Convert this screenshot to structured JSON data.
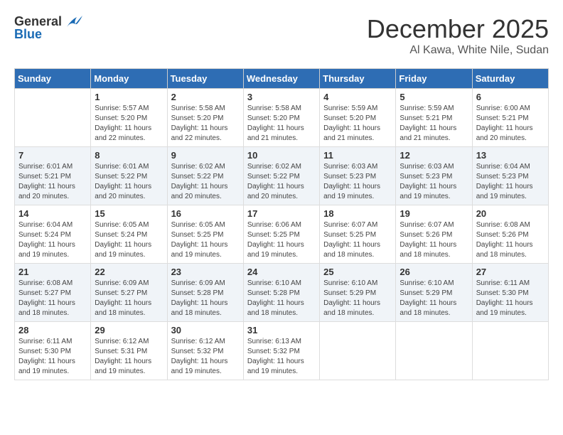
{
  "logo": {
    "line1": "General",
    "line2": "Blue"
  },
  "title": "December 2025",
  "location": "Al Kawa, White Nile, Sudan",
  "days_of_week": [
    "Sunday",
    "Monday",
    "Tuesday",
    "Wednesday",
    "Thursday",
    "Friday",
    "Saturday"
  ],
  "weeks": [
    [
      {
        "day": "",
        "sunrise": "",
        "sunset": "",
        "daylight": ""
      },
      {
        "day": "1",
        "sunrise": "Sunrise: 5:57 AM",
        "sunset": "Sunset: 5:20 PM",
        "daylight": "Daylight: 11 hours and 22 minutes."
      },
      {
        "day": "2",
        "sunrise": "Sunrise: 5:58 AM",
        "sunset": "Sunset: 5:20 PM",
        "daylight": "Daylight: 11 hours and 22 minutes."
      },
      {
        "day": "3",
        "sunrise": "Sunrise: 5:58 AM",
        "sunset": "Sunset: 5:20 PM",
        "daylight": "Daylight: 11 hours and 21 minutes."
      },
      {
        "day": "4",
        "sunrise": "Sunrise: 5:59 AM",
        "sunset": "Sunset: 5:20 PM",
        "daylight": "Daylight: 11 hours and 21 minutes."
      },
      {
        "day": "5",
        "sunrise": "Sunrise: 5:59 AM",
        "sunset": "Sunset: 5:21 PM",
        "daylight": "Daylight: 11 hours and 21 minutes."
      },
      {
        "day": "6",
        "sunrise": "Sunrise: 6:00 AM",
        "sunset": "Sunset: 5:21 PM",
        "daylight": "Daylight: 11 hours and 20 minutes."
      }
    ],
    [
      {
        "day": "7",
        "sunrise": "Sunrise: 6:01 AM",
        "sunset": "Sunset: 5:21 PM",
        "daylight": "Daylight: 11 hours and 20 minutes."
      },
      {
        "day": "8",
        "sunrise": "Sunrise: 6:01 AM",
        "sunset": "Sunset: 5:22 PM",
        "daylight": "Daylight: 11 hours and 20 minutes."
      },
      {
        "day": "9",
        "sunrise": "Sunrise: 6:02 AM",
        "sunset": "Sunset: 5:22 PM",
        "daylight": "Daylight: 11 hours and 20 minutes."
      },
      {
        "day": "10",
        "sunrise": "Sunrise: 6:02 AM",
        "sunset": "Sunset: 5:22 PM",
        "daylight": "Daylight: 11 hours and 20 minutes."
      },
      {
        "day": "11",
        "sunrise": "Sunrise: 6:03 AM",
        "sunset": "Sunset: 5:23 PM",
        "daylight": "Daylight: 11 hours and 19 minutes."
      },
      {
        "day": "12",
        "sunrise": "Sunrise: 6:03 AM",
        "sunset": "Sunset: 5:23 PM",
        "daylight": "Daylight: 11 hours and 19 minutes."
      },
      {
        "day": "13",
        "sunrise": "Sunrise: 6:04 AM",
        "sunset": "Sunset: 5:23 PM",
        "daylight": "Daylight: 11 hours and 19 minutes."
      }
    ],
    [
      {
        "day": "14",
        "sunrise": "Sunrise: 6:04 AM",
        "sunset": "Sunset: 5:24 PM",
        "daylight": "Daylight: 11 hours and 19 minutes."
      },
      {
        "day": "15",
        "sunrise": "Sunrise: 6:05 AM",
        "sunset": "Sunset: 5:24 PM",
        "daylight": "Daylight: 11 hours and 19 minutes."
      },
      {
        "day": "16",
        "sunrise": "Sunrise: 6:05 AM",
        "sunset": "Sunset: 5:25 PM",
        "daylight": "Daylight: 11 hours and 19 minutes."
      },
      {
        "day": "17",
        "sunrise": "Sunrise: 6:06 AM",
        "sunset": "Sunset: 5:25 PM",
        "daylight": "Daylight: 11 hours and 19 minutes."
      },
      {
        "day": "18",
        "sunrise": "Sunrise: 6:07 AM",
        "sunset": "Sunset: 5:25 PM",
        "daylight": "Daylight: 11 hours and 18 minutes."
      },
      {
        "day": "19",
        "sunrise": "Sunrise: 6:07 AM",
        "sunset": "Sunset: 5:26 PM",
        "daylight": "Daylight: 11 hours and 18 minutes."
      },
      {
        "day": "20",
        "sunrise": "Sunrise: 6:08 AM",
        "sunset": "Sunset: 5:26 PM",
        "daylight": "Daylight: 11 hours and 18 minutes."
      }
    ],
    [
      {
        "day": "21",
        "sunrise": "Sunrise: 6:08 AM",
        "sunset": "Sunset: 5:27 PM",
        "daylight": "Daylight: 11 hours and 18 minutes."
      },
      {
        "day": "22",
        "sunrise": "Sunrise: 6:09 AM",
        "sunset": "Sunset: 5:27 PM",
        "daylight": "Daylight: 11 hours and 18 minutes."
      },
      {
        "day": "23",
        "sunrise": "Sunrise: 6:09 AM",
        "sunset": "Sunset: 5:28 PM",
        "daylight": "Daylight: 11 hours and 18 minutes."
      },
      {
        "day": "24",
        "sunrise": "Sunrise: 6:10 AM",
        "sunset": "Sunset: 5:28 PM",
        "daylight": "Daylight: 11 hours and 18 minutes."
      },
      {
        "day": "25",
        "sunrise": "Sunrise: 6:10 AM",
        "sunset": "Sunset: 5:29 PM",
        "daylight": "Daylight: 11 hours and 18 minutes."
      },
      {
        "day": "26",
        "sunrise": "Sunrise: 6:10 AM",
        "sunset": "Sunset: 5:29 PM",
        "daylight": "Daylight: 11 hours and 18 minutes."
      },
      {
        "day": "27",
        "sunrise": "Sunrise: 6:11 AM",
        "sunset": "Sunset: 5:30 PM",
        "daylight": "Daylight: 11 hours and 19 minutes."
      }
    ],
    [
      {
        "day": "28",
        "sunrise": "Sunrise: 6:11 AM",
        "sunset": "Sunset: 5:30 PM",
        "daylight": "Daylight: 11 hours and 19 minutes."
      },
      {
        "day": "29",
        "sunrise": "Sunrise: 6:12 AM",
        "sunset": "Sunset: 5:31 PM",
        "daylight": "Daylight: 11 hours and 19 minutes."
      },
      {
        "day": "30",
        "sunrise": "Sunrise: 6:12 AM",
        "sunset": "Sunset: 5:32 PM",
        "daylight": "Daylight: 11 hours and 19 minutes."
      },
      {
        "day": "31",
        "sunrise": "Sunrise: 6:13 AM",
        "sunset": "Sunset: 5:32 PM",
        "daylight": "Daylight: 11 hours and 19 minutes."
      },
      {
        "day": "",
        "sunrise": "",
        "sunset": "",
        "daylight": ""
      },
      {
        "day": "",
        "sunrise": "",
        "sunset": "",
        "daylight": ""
      },
      {
        "day": "",
        "sunrise": "",
        "sunset": "",
        "daylight": ""
      }
    ]
  ]
}
